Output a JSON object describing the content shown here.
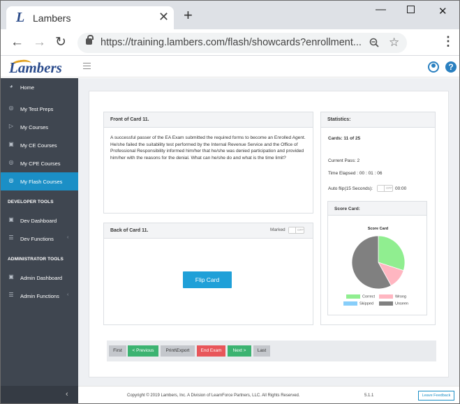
{
  "browser": {
    "tab_title": "Lambers",
    "tab_logo": "L",
    "new_tab": "+",
    "tab_close": "✕",
    "url": "https://training.lambers.com/flash/showcards?enrollment..."
  },
  "header": {
    "brand": "Lambers"
  },
  "sidebar": {
    "items": [
      {
        "label": "Home",
        "icon": "speedometer-icon"
      },
      {
        "label": "My Test Preps",
        "icon": "target-icon"
      },
      {
        "label": "My Courses",
        "icon": "play-icon"
      },
      {
        "label": "My CE Courses",
        "icon": "folder-icon"
      },
      {
        "label": "My CPE Courses",
        "icon": "target-icon"
      },
      {
        "label": "My Flash Courses",
        "icon": "target-icon"
      }
    ],
    "developer_heading": "DEVELOPER TOOLS",
    "developer_items": [
      {
        "label": "Dev Dashboard",
        "icon": "folder-icon"
      },
      {
        "label": "Dev Functions",
        "icon": "list-icon"
      }
    ],
    "admin_heading": "ADMINISTRATOR TOOLS",
    "admin_items": [
      {
        "label": "Admin Dashboard",
        "icon": "folder-icon"
      },
      {
        "label": "Admin Functions",
        "icon": "list-icon"
      }
    ],
    "active_color": "#1b8fc6"
  },
  "front": {
    "title": "Front of Card 11.",
    "text": "A successful passer of the EA Exam submitted the required forms to become an Enrolled Agent. He/she failed the suitability test performed by the Internal Revenue Service and the Office of Professional Responsibility informed him/her that he/she was denied participation and provided him/her with the reasons for the denial. What can he/she do and what is the time limit?"
  },
  "back": {
    "title": "Back of Card 11.",
    "marked_label": "Marked",
    "toggle_off": "OFF",
    "flip_label": "Flip Card"
  },
  "stats": {
    "title": "Statistics:",
    "cards": "Cards: 11 of 25",
    "current_pass": "Current Pass: 2",
    "time_elapsed": "Time Elapsed : 00 : 01 : 06",
    "auto_flip": "Auto flip(15 Seconds):",
    "auto_flip_off": "OFF",
    "auto_flip_time": "00:00",
    "score_card_title": "Score Card:"
  },
  "chart_data": {
    "type": "pie",
    "title": "Score Card",
    "categories": [
      "Correct",
      "Wrong",
      "Skipped",
      "Unseen"
    ],
    "values": [
      30,
      12,
      0,
      58
    ],
    "colors": [
      "#90ee90",
      "#ffb6c1",
      "#87cefa",
      "#808080"
    ]
  },
  "pager": {
    "first": "First",
    "previous": "< Previous",
    "print_export": "Print\\Export",
    "end_exam": "End Exam",
    "next": "Next >",
    "last": "Last"
  },
  "footer": {
    "copyright": "Copyright © 2019 Lambers, Inc. A Division of LearnForce Partners, LLC. All Rights Reserved.",
    "version": "5.1.1",
    "feedback": "Leave Feedback"
  }
}
